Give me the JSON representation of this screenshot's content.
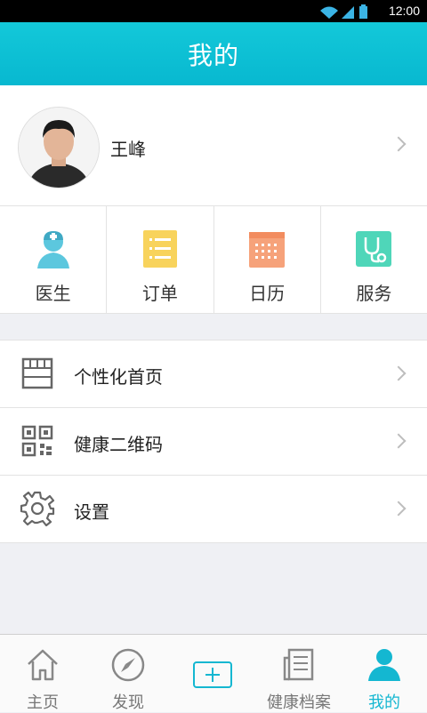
{
  "status_bar": {
    "time": "12:00"
  },
  "header": {
    "title": "我的"
  },
  "profile": {
    "name": "王峰"
  },
  "quick_actions": [
    {
      "label": "医生",
      "icon": "doctor-icon",
      "color": "#5cc7de"
    },
    {
      "label": "订单",
      "icon": "order-list-icon",
      "color": "#f8d35c"
    },
    {
      "label": "日历",
      "icon": "calendar-icon",
      "color": "#f6a27a"
    },
    {
      "label": "服务",
      "icon": "stethoscope-icon",
      "color": "#4fd6b9"
    }
  ],
  "menu": [
    {
      "label": "个性化首页",
      "icon": "custom-homepage-icon"
    },
    {
      "label": "健康二维码",
      "icon": "qr-code-icon"
    },
    {
      "label": "设置",
      "icon": "gear-icon"
    }
  ],
  "tabbar": [
    {
      "label": "主页",
      "icon": "home-icon"
    },
    {
      "label": "发现",
      "icon": "compass-icon"
    },
    {
      "label": "",
      "icon": "plus-icon"
    },
    {
      "label": "健康档案",
      "icon": "health-record-icon"
    },
    {
      "label": "我的",
      "icon": "user-icon",
      "active": true
    }
  ],
  "colors": {
    "accent": "#14b7d1",
    "header": "#0bbfd5"
  }
}
